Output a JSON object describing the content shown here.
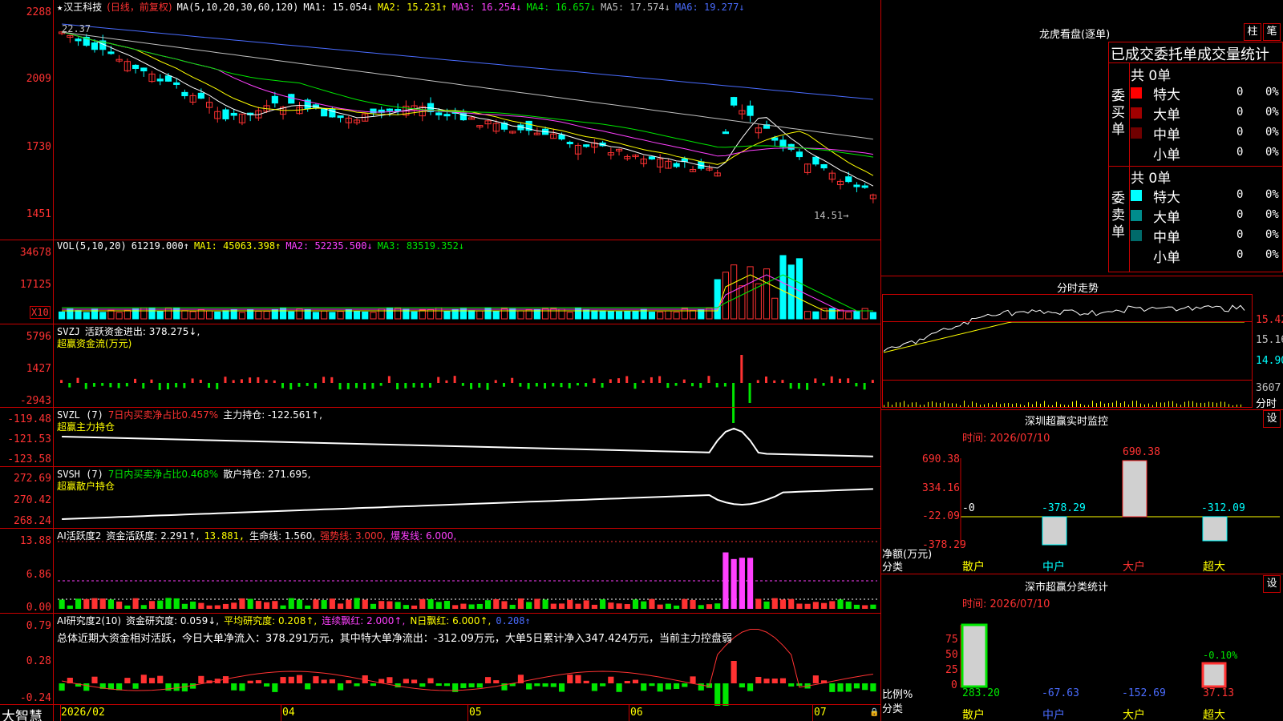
{
  "main": {
    "title_star": "★",
    "stock_name": "汉王科技",
    "period_note": "(日线，前复权)",
    "ma_label": "MA(5,10,20,30,60,120)",
    "ma_values": [
      {
        "label": "MA1: 15.054↓",
        "color": "#ffffff"
      },
      {
        "label": "MA2: 15.231↑",
        "color": "#ffff00"
      },
      {
        "label": "MA3: 16.254↓",
        "color": "#ff40ff"
      },
      {
        "label": "MA4: 16.657↓",
        "color": "#00e600"
      },
      {
        "label": "MA5: 17.574↓",
        "color": "#c0c0c0"
      },
      {
        "label": "MA6: 19.277↓",
        "color": "#4a6cff"
      }
    ],
    "y_ticks": [
      "2288",
      "2009",
      "1730",
      "1451"
    ],
    "high_label": "22.37",
    "low_label": "14.51→"
  },
  "volume": {
    "label": "VOL(5,10,20)",
    "value": "61219.000↑",
    "ma1": "MA1: 45063.398↑",
    "ma2": "MA2: 52235.500↓",
    "ma3": "MA3: 83519.352↓",
    "y_ticks": [
      "34678",
      "17125"
    ],
    "unit": "X10"
  },
  "svzj": {
    "label": "SVZJ",
    "desc": "活跃资金进出: 378.275↓,",
    "sub": "超赢资金流(万元)",
    "y_ticks": [
      "5796",
      "1427",
      "-2943"
    ]
  },
  "svzl": {
    "label": "SVZL (7)",
    "ratio": "7日内买卖净占比0.457%",
    "hold": "主力持仓: -122.561↑,",
    "sub": "超赢主力持仓",
    "y_ticks": [
      "-119.48",
      "-121.53",
      "-123.58"
    ]
  },
  "svsh": {
    "label": "SVSH (7)",
    "ratio": "7日内买卖净占比0.468%",
    "hold": "散户持仓: 271.695,",
    "sub": "超赢散户持仓",
    "y_ticks": [
      "272.69",
      "270.42",
      "268.24"
    ]
  },
  "ai1": {
    "label": "AI活跃度2",
    "active": "资金活跃度: 2.291↑,",
    "v2": "13.881,",
    "life": "生命线: 1.560,",
    "strong": "强势线: 3.000,",
    "burst": "爆发线: 6.000,",
    "y_ticks": [
      "13.88",
      "6.86",
      "0.00"
    ]
  },
  "ai2": {
    "label": "AI研究度2(10)",
    "research": "资金研究度: 0.059↓,",
    "avg": "平均研究度: 0.208↑,",
    "red": "连续飘红: 2.000↑,",
    "nred": "N日飘红: 6.000↑,",
    "last": "0.208↑",
    "summary": "总体近期大资金相对活跃，今日大单净流入：378.291万元，其中特大单净流出：-312.09万元，大单5日累计净入347.424万元，当前主力控盘弱",
    "y_ticks": [
      "0.79",
      "0.28",
      "-0.24"
    ]
  },
  "xaxis": {
    "labels": [
      "2026/02",
      "04",
      "05",
      "06",
      "07"
    ],
    "brand": "大智慧"
  },
  "dragon": {
    "title": "龙虎看盘(逐单)",
    "btn1": "柱",
    "btn2": "笔",
    "header": "已成交委托单成交量统计",
    "buy_label": "委买单",
    "sell_label": "委卖单",
    "buy_total": "共 0单",
    "sell_total": "共 0单",
    "buy_rows": [
      {
        "name": "特大",
        "qty": "0",
        "pct": "0%",
        "color": "#ff0000"
      },
      {
        "name": "大单",
        "qty": "0",
        "pct": "0%",
        "color": "#a00000"
      },
      {
        "name": "中单",
        "qty": "0",
        "pct": "0%",
        "color": "#700000"
      },
      {
        "name": "小单",
        "qty": "0",
        "pct": "0%",
        "color": "#000000"
      }
    ],
    "sell_rows": [
      {
        "name": "特大",
        "qty": "0",
        "pct": "0%",
        "color": "#00ffff"
      },
      {
        "name": "大单",
        "qty": "0",
        "pct": "0%",
        "color": "#008c8c"
      },
      {
        "name": "中单",
        "qty": "0",
        "pct": "0%",
        "color": "#006a6a"
      },
      {
        "name": "小单",
        "qty": "0",
        "pct": "0%",
        "color": "#000000"
      }
    ]
  },
  "intraday": {
    "title": "分时走势",
    "prices": [
      "15.42",
      "15.16",
      "14.90"
    ],
    "vol_label": "3607",
    "bottom": "分时"
  },
  "realtime": {
    "title": "深圳超赢实时监控",
    "btn": "设",
    "time": "时间: 2026/07/10",
    "y_ticks": [
      "690.38",
      "334.16",
      "-22.09",
      "-378.29"
    ],
    "net_label": "净额(万元)",
    "cat_label": "分类",
    "categories": [
      "散户",
      "中户",
      "大户",
      "超大"
    ],
    "values": [
      "-0",
      "-378.29",
      "690.38",
      "-312.09"
    ]
  },
  "classify": {
    "title": "深市超赢分类统计",
    "btn": "设",
    "time": "时间: 2026/07/10",
    "y_ticks": [
      "75",
      "50",
      "25",
      "0"
    ],
    "ratio_label": "比例%",
    "cat_label": "分类",
    "categories": [
      "散户",
      "中户",
      "大户",
      "超大"
    ],
    "values": [
      "283.20",
      "-67.63",
      "-152.69",
      "37.13"
    ],
    "pct_label": "-0.10%"
  }
}
